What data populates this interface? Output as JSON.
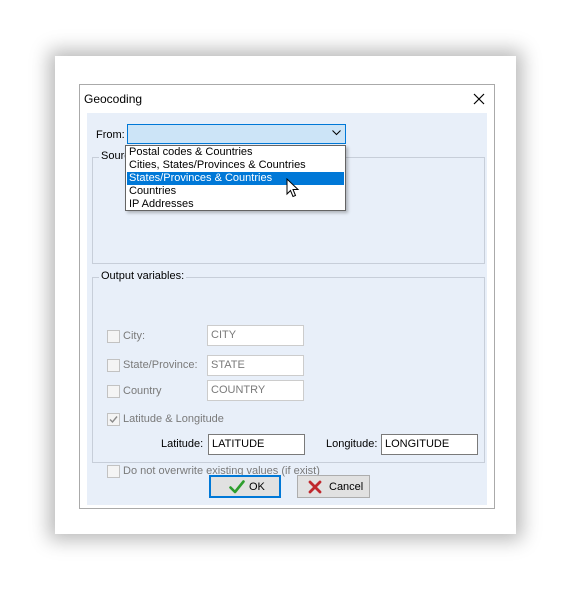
{
  "window": {
    "title": "Geocoding"
  },
  "from": {
    "label": "From:",
    "value": "",
    "options": [
      "Postal codes & Countries",
      "Cities, States/Provinces & Countries",
      "States/Provinces & Countries",
      "Countries",
      "IP Addresses"
    ],
    "highlighted_option": "States/Provinces & Countries"
  },
  "source_group": {
    "title": "Sourc"
  },
  "output_group": {
    "title": "Output variables:",
    "city": {
      "label": "City:",
      "value": "CITY",
      "checked": false
    },
    "state": {
      "label": "State/Province:",
      "value": "STATE",
      "checked": false
    },
    "country": {
      "label": "Country",
      "value": "COUNTRY",
      "checked": false
    },
    "latlong": {
      "label": "Latitude  & Longitude",
      "checked": true
    },
    "latitude": {
      "label": "Latitude:",
      "value": "LATITUDE"
    },
    "longitude": {
      "label": "Longitude:",
      "value": "LONGITUDE"
    },
    "no_overwrite": {
      "label": "Do not overwrite existing values (if exist)",
      "checked": false
    }
  },
  "buttons": {
    "ok": "OK",
    "cancel": "Cancel"
  },
  "colors": {
    "accent": "#0078d7",
    "client_bg": "#e8eff9",
    "ok_check": "#2e9e2e",
    "cancel_x": "#c0282d"
  }
}
